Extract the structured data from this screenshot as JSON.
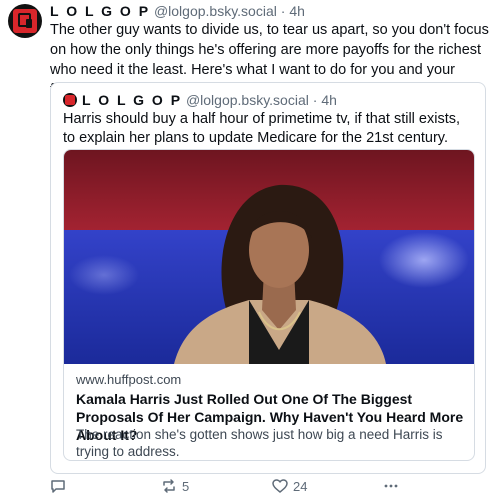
{
  "post": {
    "author_name": "L O L G O P",
    "handle": "@lolgop.bsky.social",
    "separator": "·",
    "time": "4h",
    "text": "The other guy wants to divide us, to tear us apart, so you don't focus on how the only things he's offering are more payoffs for the richest who need it the least. Here's what I want to do for you and your family."
  },
  "quote": {
    "author_name": "L O L G O P",
    "handle": "@lolgop.bsky.social",
    "separator": "·",
    "time": "4h",
    "text": "Harris should buy a half hour of primetime tv, if that still exists, to explain her plans to update Medicare for the 21st century.",
    "link_card": {
      "domain": "www.huffpost.com",
      "title": "Kamala Harris Just Rolled Out One Of The Biggest Proposals Of Her Campaign. Why Haven't You Heard More About It?",
      "description": "The reaction she's gotten shows just how big a need Harris is trying to address."
    }
  },
  "actions": {
    "reply_icon": "comment-icon",
    "reply_count": "",
    "repost_icon": "repost-icon",
    "repost_count": "5",
    "like_icon": "heart-icon",
    "like_count": "24",
    "more_icon": "ellipsis-icon"
  },
  "colors": {
    "text": "#0b0f14",
    "muted": "#5f6b78",
    "border": "#d6dce3",
    "avatar_red": "#d8262b"
  }
}
